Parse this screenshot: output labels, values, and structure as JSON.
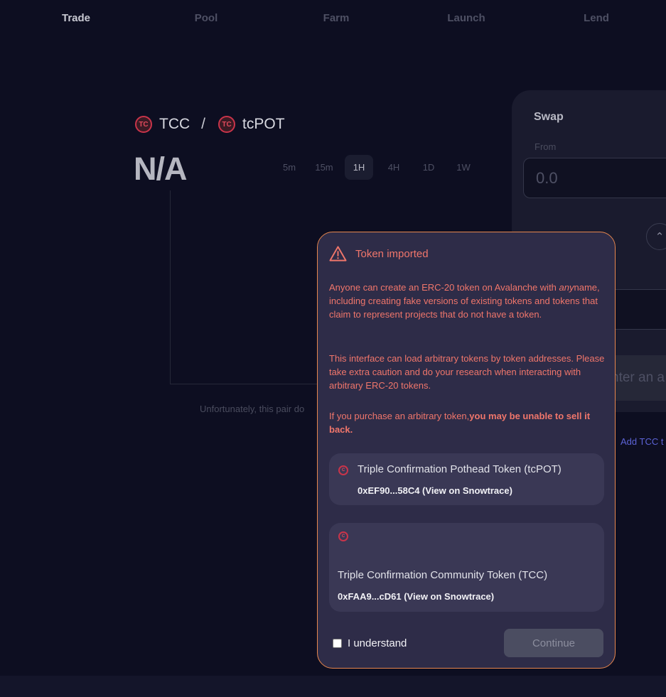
{
  "nav": {
    "items": [
      {
        "label": "Trade"
      },
      {
        "label": "Pool"
      },
      {
        "label": "Farm"
      },
      {
        "label": "Launch"
      },
      {
        "label": "Lend"
      }
    ]
  },
  "pair": {
    "base_symbol": "TCC",
    "separator": "/",
    "quote_symbol": "tcPOT",
    "logo_glyph": "TC"
  },
  "price": "N/A",
  "intervals": [
    "5m",
    "15m",
    "1H",
    "4H",
    "1D",
    "1W"
  ],
  "selected_interval": "1H",
  "chart_note": "Unfortunately, this pair do",
  "swap": {
    "title": "Swap",
    "from_label": "From",
    "from_placeholder": "0.0",
    "switch_icon": "chevron-up-down-icon",
    "button_label": "nter an a",
    "add_link": "Add TCC t"
  },
  "modal": {
    "title": "Token imported",
    "icon": "warning-triangle-icon",
    "para1_before": "Anyone can create an ERC-20 token on Avalanche with ",
    "para1_em": "any",
    "para1_after": "name, including creating fake versions of existing tokens and tokens that claim to represent projects that do not have a token.",
    "para2": "This interface can load arbitrary tokens by token addresses. Please take extra caution and do your research when interacting with arbitrary ERC-20 tokens.",
    "para3_before": "If you purchase an arbitrary token,",
    "para3_bold": "you may be unable to sell it back.",
    "tokens": [
      {
        "name": "Triple Confirmation Pothead Token (tcPOT)",
        "address": "0xEF90...58C4 (View on Snowtrace)"
      },
      {
        "name": "Triple Confirmation Community Token (TCC)",
        "address": "0xFAA9...cD61 (View on Snowtrace)"
      }
    ],
    "checkbox_label": "I understand",
    "continue_label": "Continue"
  },
  "colors": {
    "background": "#0d0e21",
    "modal_bg": "#2e2c48",
    "modal_border": "#e7864d",
    "warning_text": "#f0766b",
    "token_accent": "#c9344a"
  }
}
